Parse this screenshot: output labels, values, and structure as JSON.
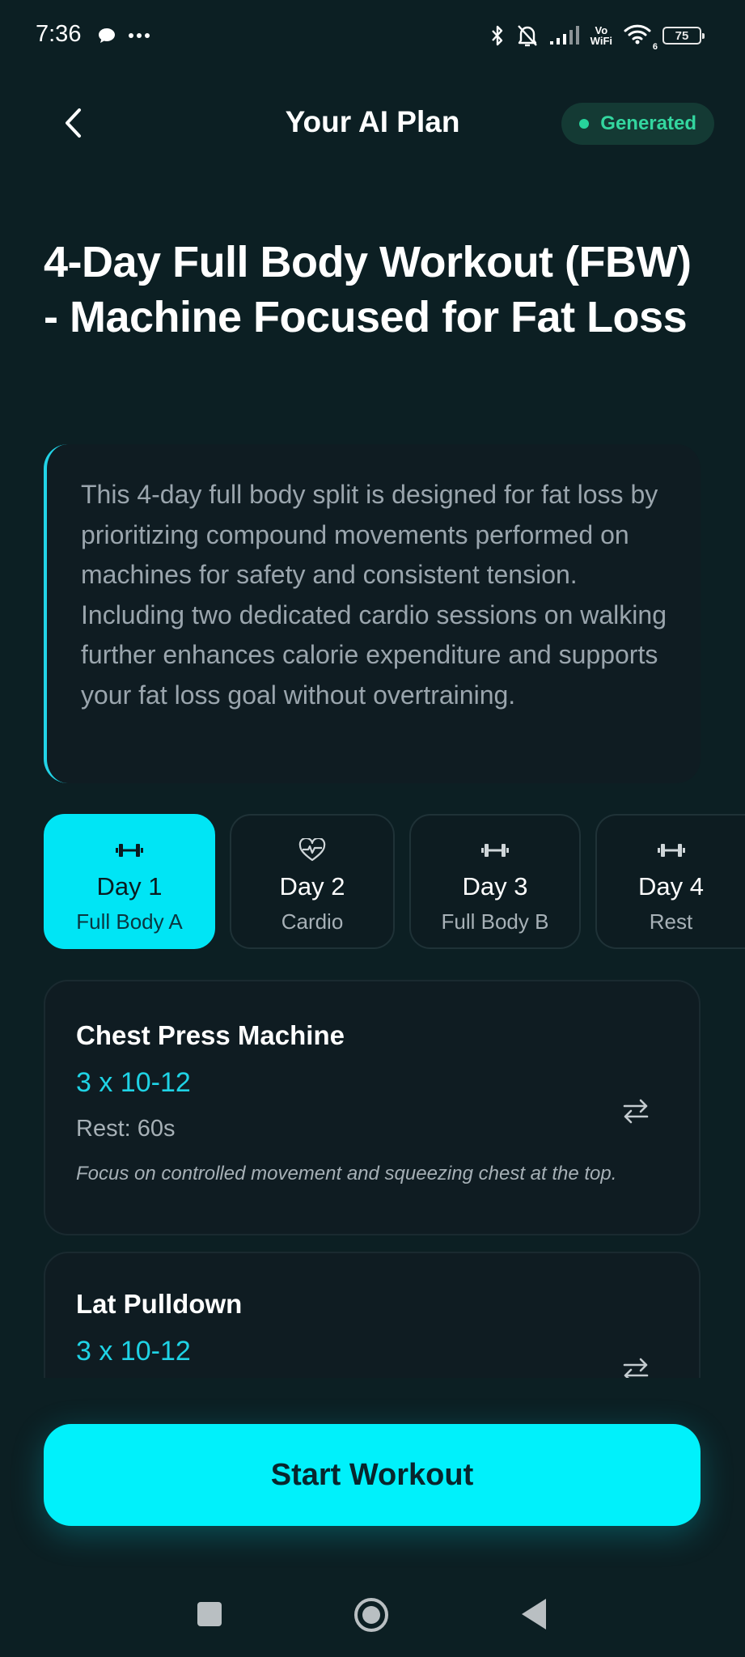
{
  "status_bar": {
    "time": "7:36",
    "vowifi_top": "Vo",
    "vowifi_bottom": "WiFi",
    "wifi_sub": "6",
    "battery": "75"
  },
  "header": {
    "title": "Your AI Plan",
    "badge": "Generated"
  },
  "plan": {
    "title": "4-Day Full Body Workout (FBW) - Machine Focused for Fat Loss",
    "description": "This 4-day full body split is designed for fat loss by prioritizing compound movements performed on machines for safety and consistent tension. Including two dedicated cardio sessions on walking further enhances calorie expenditure and supports your fat loss goal without overtraining."
  },
  "days": [
    {
      "label": "Day 1",
      "subtitle": "Full Body A",
      "icon": "dumbbell-icon",
      "active": true
    },
    {
      "label": "Day 2",
      "subtitle": "Cardio",
      "icon": "heart-pulse-icon",
      "active": false
    },
    {
      "label": "Day 3",
      "subtitle": "Full Body B",
      "icon": "dumbbell-icon",
      "active": false
    },
    {
      "label": "Day 4",
      "subtitle": "Rest",
      "icon": "dumbbell-icon",
      "active": false
    }
  ],
  "exercises": [
    {
      "name": "Chest Press Machine",
      "sets": "3 x 10-12",
      "rest": "Rest: 60s",
      "note": "Focus on controlled movement and squeezing chest at the top."
    },
    {
      "name": "Lat Pulldown",
      "sets": "3 x 10-12"
    }
  ],
  "cta": {
    "label": "Start Workout"
  },
  "colors": {
    "background": "#0c1f23",
    "accent": "#00f1fb",
    "badge_green": "#33d69f"
  }
}
